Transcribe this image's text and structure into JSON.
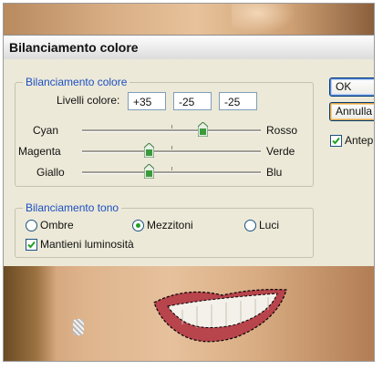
{
  "window": {
    "title": "Bilanciamento colore"
  },
  "color_balance": {
    "group_label": "Bilanciamento colore",
    "levels_label": "Livelli colore:",
    "levels": [
      "+35",
      "-25",
      "-25"
    ],
    "sliders": [
      {
        "left": "Cyan",
        "right": "Rosso",
        "value": 35
      },
      {
        "left": "Magenta",
        "right": "Verde",
        "value": -25
      },
      {
        "left": "Giallo",
        "right": "Blu",
        "value": -25
      }
    ]
  },
  "tone_balance": {
    "group_label": "Bilanciamento tono",
    "options": [
      "Ombre",
      "Mezzitoni",
      "Luci"
    ],
    "selected": "Mezzitoni",
    "preserve_luminosity_label": "Mantieni luminosità",
    "preserve_luminosity_checked": true
  },
  "buttons": {
    "ok": "OK",
    "cancel": "Annulla",
    "preview": "Anteprima",
    "preview_checked": true
  },
  "colors": {
    "legend_blue": "#1c4fc2",
    "slider_thumb": "#3c9a3c",
    "selection_marquee": "#000000"
  },
  "icons": {
    "radio": "radio-icon",
    "check": "checkmark-icon",
    "slider_thumb": "slider-thumb-icon"
  }
}
